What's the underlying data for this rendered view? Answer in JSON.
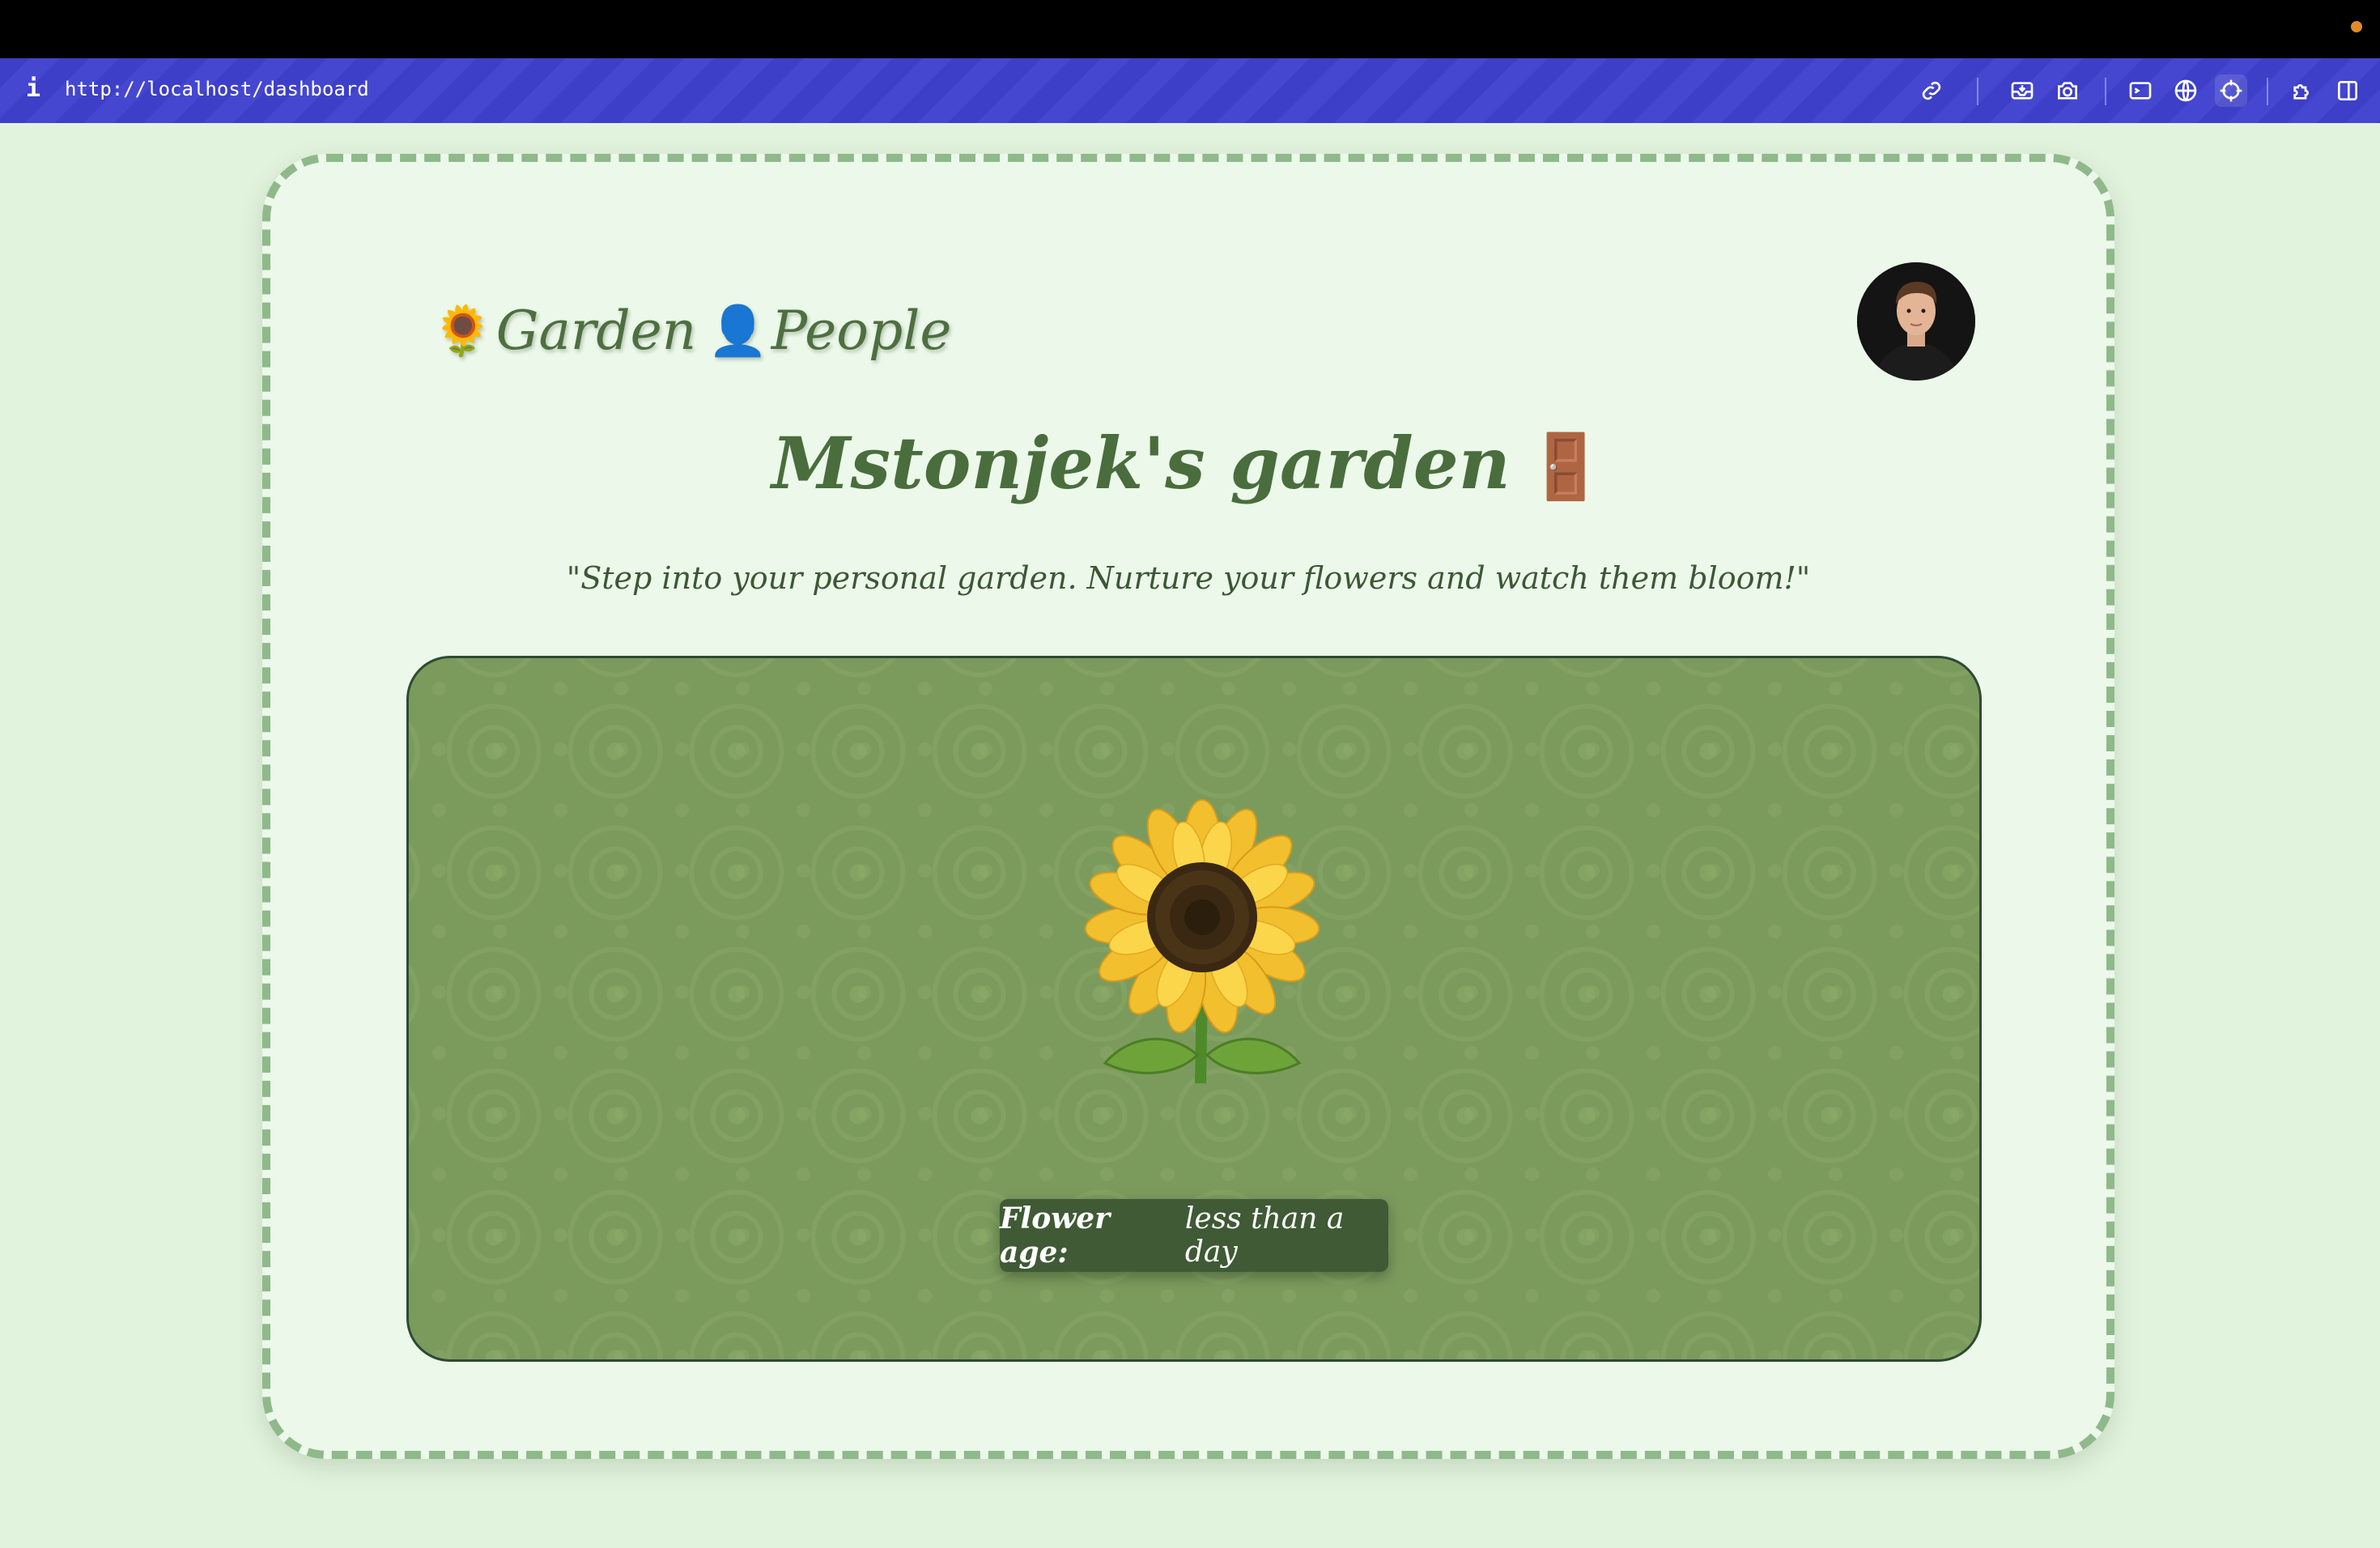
{
  "browser": {
    "info_glyph": "i",
    "url": "http://localhost/dashboard"
  },
  "nav": {
    "garden": {
      "emoji": "🌻",
      "label": "Garden"
    },
    "people": {
      "emoji": "👤",
      "label": "People"
    }
  },
  "page": {
    "title": "Mstonjek's garden",
    "title_emoji": "🚪",
    "subtitle": "\"Step into your personal garden. Nurture your flowers and watch them bloom!\""
  },
  "flower": {
    "age_label": "Flower age:",
    "age_value": "less than a day"
  },
  "colors": {
    "url_bar": "#3d3fc8",
    "page_bg": "#e2f3dd",
    "card_border": "#8fb98a",
    "garden_bg": "#7b9b5d",
    "text_green": "#4a6d3d"
  },
  "icons": [
    "link-icon",
    "inbox-icon",
    "camera-icon",
    "terminal-icon",
    "globe-icon",
    "crosshair-icon",
    "extensions-icon",
    "split-view-icon"
  ]
}
